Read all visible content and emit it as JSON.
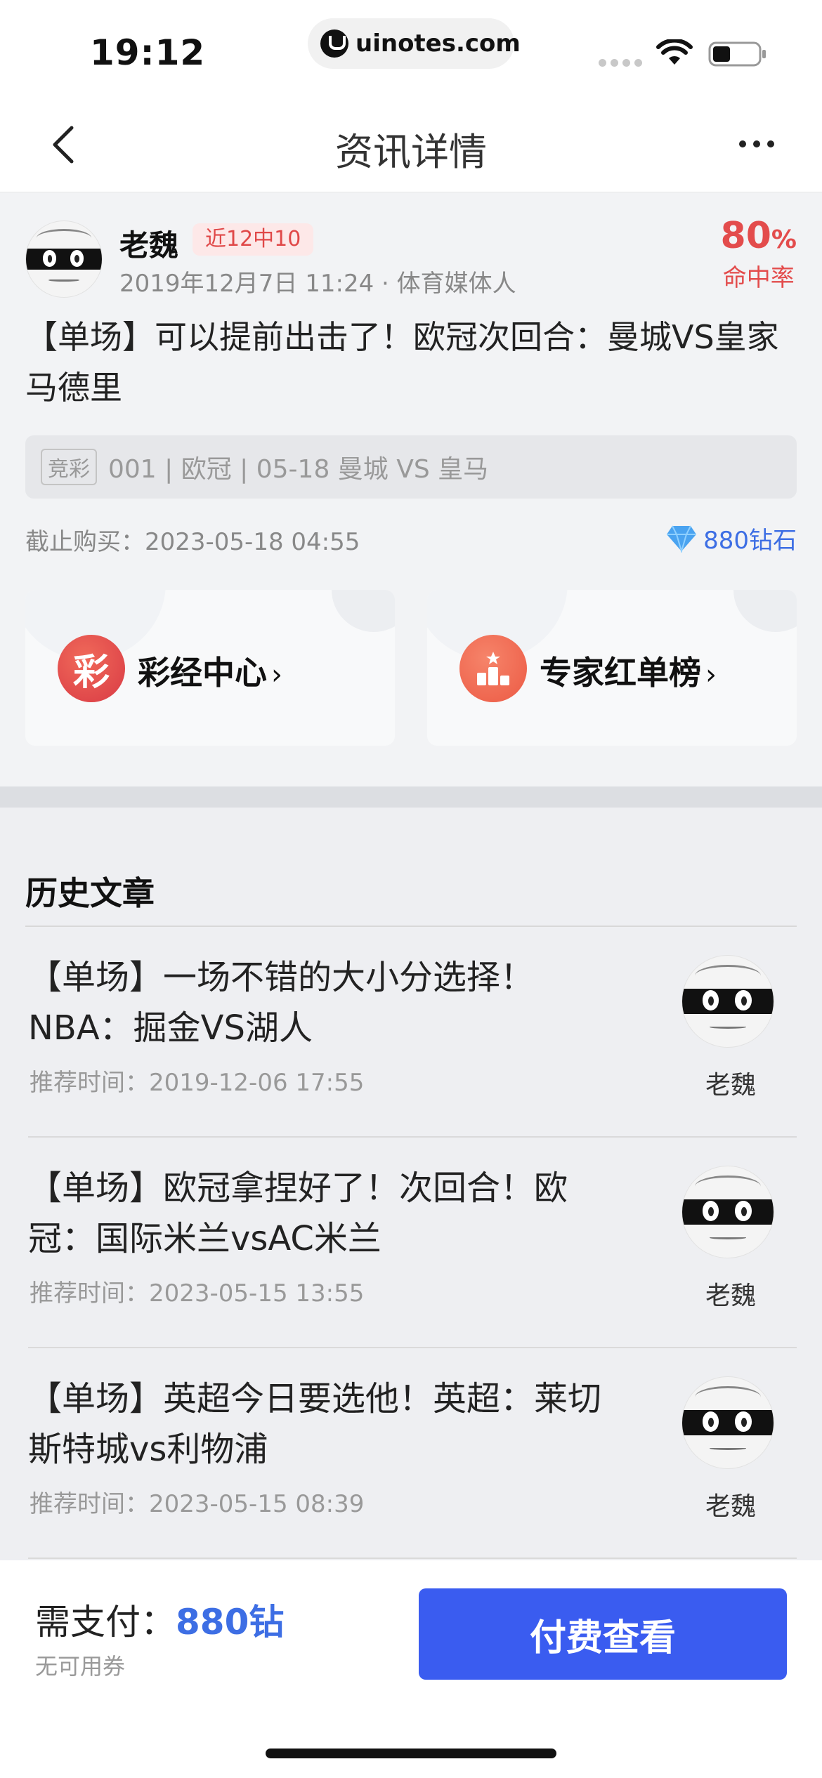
{
  "status_bar": {
    "time": "19:12",
    "url": "uinotes.com"
  },
  "nav": {
    "title": "资讯详情"
  },
  "author": {
    "name": "老魏",
    "badge": "近12中10",
    "meta": "2019年12月7日 11:24 · 体育媒体人",
    "hit_rate_value": "80",
    "hit_rate_unit": "%",
    "hit_rate_label": "命中率"
  },
  "article": {
    "title": "【单场】可以提前出击了！欧冠次回合：曼城VS皇家马德里",
    "match_tag": "竞彩",
    "match_info": "001 | 欧冠 | 05-18 曼城 VS 皇马",
    "deadline": "截止购买：2023-05-18 04:55",
    "price": "880钻石"
  },
  "promos": [
    {
      "icon_text": "彩",
      "label": "彩经中心",
      "icon": "lottery-icon",
      "color": "#e8483f"
    },
    {
      "label": "专家红单榜",
      "icon": "ranking-podium-icon",
      "color": "#f0664a"
    }
  ],
  "history": {
    "title": "历史文章",
    "items": [
      {
        "title": "【单场】一场不错的大小分选择！NBA：掘金VS湖人",
        "time": "推荐时间：2019-12-06 17:55",
        "author": "老魏"
      },
      {
        "title": "【单场】欧冠拿捏好了！次回合！欧冠：国际米兰vsAC米兰",
        "time": "推荐时间：2023-05-15 13:55",
        "author": "老魏"
      },
      {
        "title": "【单场】英超今日要选他！英超：莱切斯特城vs利物浦",
        "time": "推荐时间：2023-05-15 08:39",
        "author": "老魏"
      }
    ]
  },
  "bottom": {
    "pay_label": "需支付：",
    "pay_amount": "880钻",
    "coupon": "无可用券",
    "button": "付费查看"
  },
  "colors": {
    "accent": "#3a5cf0",
    "price_blue": "#3d6ee4",
    "hit_red": "#e34c4c"
  }
}
